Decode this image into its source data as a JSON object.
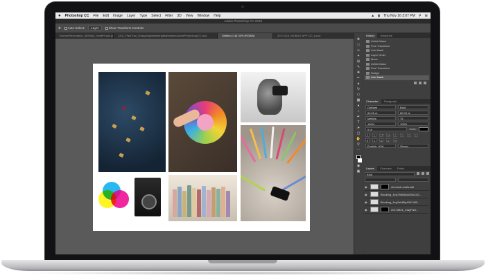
{
  "menubar": {
    "apple": "",
    "app_name": "Photoshop CC",
    "items": [
      "File",
      "Edit",
      "Image",
      "Layer",
      "Type",
      "Select",
      "Filter",
      "3D",
      "View",
      "Window",
      "Help"
    ],
    "clock": "Thu Nov 16 3:07 PM"
  },
  "window": {
    "title": "Adobe Photoshop CC 2018"
  },
  "options_bar": {
    "auto_select_label": "Auto-Select:",
    "auto_select_value": "Layer",
    "transform_label": "Show Transform Controls"
  },
  "doc_tabs": [
    "KitchenRenovation_3DStory_InviteFinals.psd",
    "1201_PaulTran_DesigningMarketingMaterialsInAdobePhotoshopCC.psd",
    "Untitled-1 @ 33% (RGB/8)",
    "20171116_MOBILE APP CO_Luxur"
  ],
  "history": {
    "tabs": [
      "History",
      "Swatches"
    ],
    "items": [
      "Unlink Mask",
      "Free Transform",
      "Link Mask",
      "Layer Order",
      "Move",
      "Unlink Mask",
      "Free Transform",
      "Nudge",
      "Link Mask"
    ],
    "selected_index": 8
  },
  "character": {
    "tabs": [
      "Character",
      "Paragraph"
    ],
    "font_family": "Gotham",
    "font_style": "Bold",
    "size": "60.05 pt",
    "leading": "80.09 pt",
    "kerning": "Metrics",
    "tracking": "75",
    "vscale": "100%",
    "hscale": "100%",
    "baseline": "0 pt",
    "color_label": "Color:",
    "language": "English: USA",
    "antialias": "Strong"
  },
  "layers": {
    "tabs": [
      "Layers",
      "Channels",
      "Paths"
    ],
    "kind_label": "Kind",
    "rows": [
      "old-book-crafts-tall",
      "Blocking_1ep798040ck5VkC02...",
      "Blocking_1ep2eb80p499Y4ll0...",
      "20170821_ClayPani..."
    ]
  },
  "colors": {
    "accent": "#00aeef",
    "magenta": "#ec008c",
    "yellow": "#fff200"
  }
}
